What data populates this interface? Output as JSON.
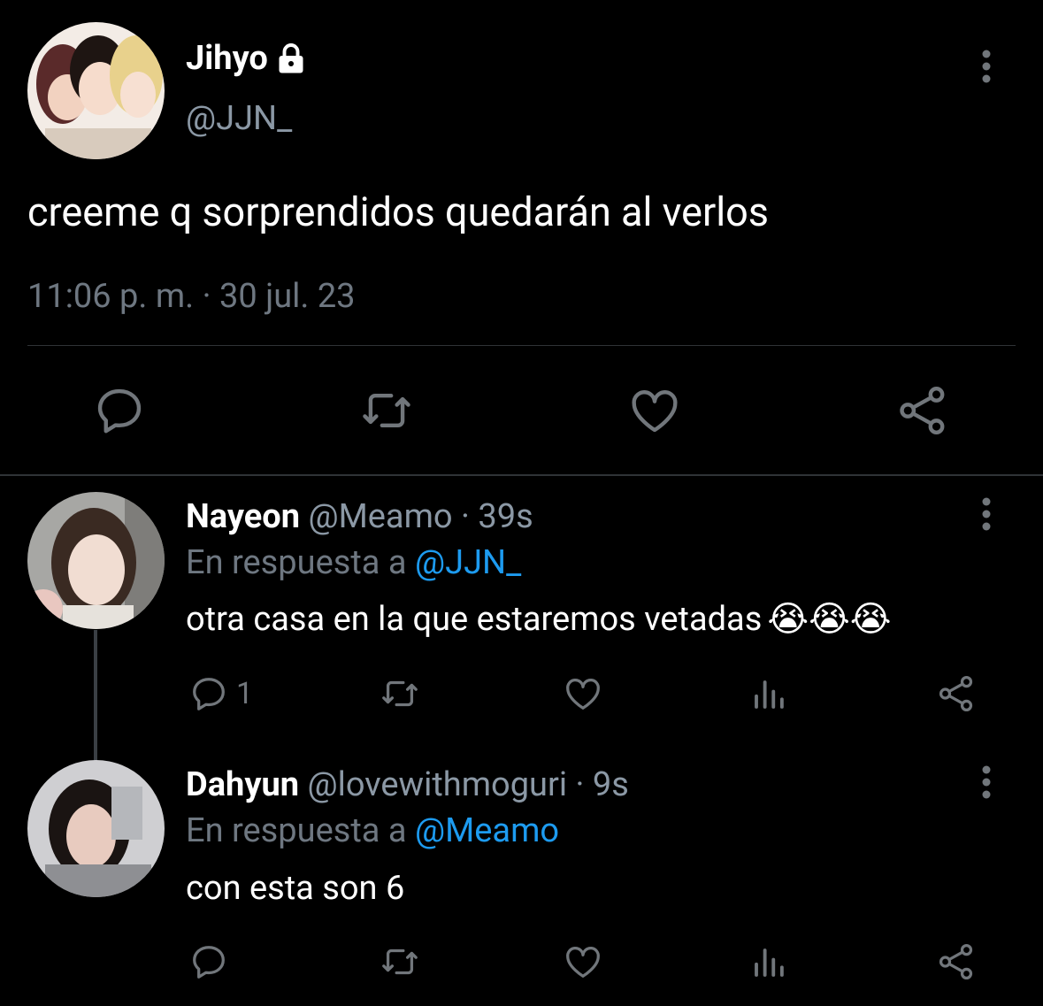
{
  "main_tweet": {
    "name": "Jihyo",
    "handle": "@JJN_",
    "text": "creeme q sorprendidos quedarán al verlos",
    "meta": "11:06 p. m. · 30 jul. 23",
    "icons": [
      "lock-icon",
      "more-vertical-icon",
      "reply-icon",
      "retweet-icon",
      "like-icon",
      "share-icon"
    ]
  },
  "replies": [
    {
      "name": "Nayeon",
      "handle": "@Meamo · 39s",
      "reply_prefix": "En respuesta a",
      "reply_to": "@JJN_",
      "text": "otra casa en la que estaremos vetadas",
      "emoji": "😭😭😭",
      "reply_count": "1"
    },
    {
      "name": "Dahyun",
      "handle": "@lovewithmoguri · 9s",
      "reply_prefix": "En respuesta a",
      "reply_to": "@Meamo",
      "text": "con esta son 6",
      "reply_count": ""
    }
  ],
  "colors": {
    "background": "#000000",
    "text": "#ffffff",
    "secondary": "#8b98a5",
    "mention": "#1d9bf0",
    "icon": "#71767b",
    "divider": "#2f3336"
  }
}
